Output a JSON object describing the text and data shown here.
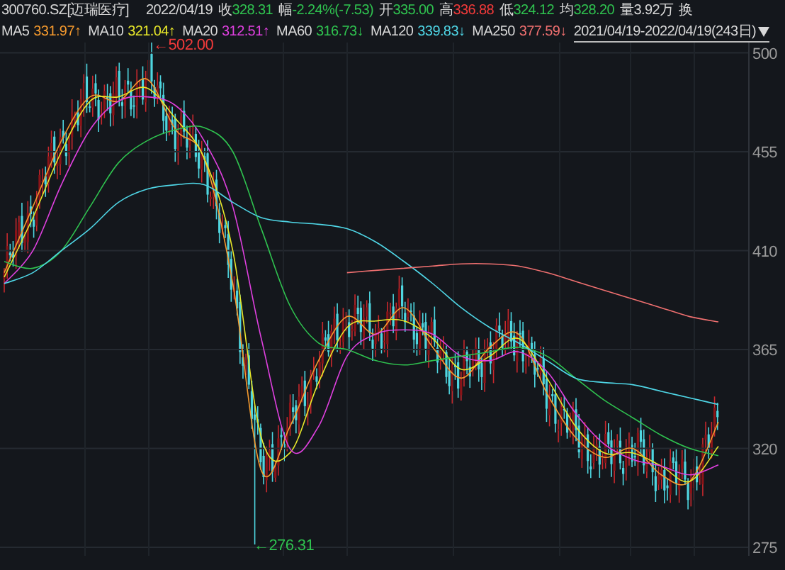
{
  "header": {
    "symbol": "300760.SZ[迈瑞医疗]",
    "date": "2022/04/19",
    "quotes": [
      {
        "label": "收",
        "value": "328.31",
        "color": "#2fc24f"
      },
      {
        "label": "幅",
        "value": "-2.24%(-7.53)",
        "color": "#2fc24f"
      },
      {
        "label": "开",
        "value": "335.00",
        "color": "#2fc24f"
      },
      {
        "label": "高",
        "value": "336.88",
        "color": "#f23a3a"
      },
      {
        "label": "低",
        "value": "324.12",
        "color": "#2fc24f"
      },
      {
        "label": "均",
        "value": "328.20",
        "color": "#2fc24f"
      },
      {
        "label": "量",
        "value": "3.92万",
        "color": "#d8d8d8"
      },
      {
        "label": "换"
      }
    ]
  },
  "ma_legend": [
    {
      "value": "331.97",
      "arrow": "↑"
    },
    {
      "value": "321.04",
      "arrow": "↑"
    },
    {
      "value": "312.51",
      "arrow": "↑"
    },
    {
      "value": "316.73",
      "arrow": "↓"
    },
    {
      "value": "339.83",
      "arrow": "↓"
    },
    {
      "value": "377.59",
      "arrow": "↓"
    }
  ],
  "range": {
    "text": "2021/04/19-2022/04/19(243日)"
  },
  "chart": {
    "high_label": "←502.00",
    "low_label": "←276.31",
    "chart_data": {
      "type": "line",
      "grid": true,
      "ylim": [
        275,
        504.7
      ],
      "yticks": [
        {
          "value": 500,
          "label": "500"
        },
        {
          "value": 455,
          "label": "455"
        },
        {
          "value": 410,
          "label": "410"
        },
        {
          "value": 365,
          "label": "365"
        },
        {
          "value": 320,
          "label": "320"
        },
        {
          "value": 275,
          "label": "275"
        }
      ],
      "series": [
        {
          "name": "MA5",
          "color": "#f59a2e",
          "values": [
            400,
            430,
            460,
            480,
            478,
            488,
            465,
            452,
            395,
            310,
            330,
            360,
            380,
            372,
            384,
            366,
            352,
            366,
            372,
            345,
            325,
            316,
            320,
            308,
            305,
            332
          ]
        },
        {
          "name": "MA10",
          "color": "#e8e82a",
          "values": [
            398,
            425,
            455,
            478,
            480,
            484,
            470,
            452,
            410,
            325,
            318,
            350,
            375,
            378,
            378,
            370,
            356,
            362,
            370,
            352,
            330,
            318,
            318,
            312,
            305,
            321
          ]
        },
        {
          "name": "MA20",
          "color": "#e040e0",
          "values": [
            395,
            410,
            440,
            465,
            478,
            480,
            476,
            460,
            430,
            370,
            320,
            330,
            362,
            372,
            374,
            372,
            362,
            360,
            364,
            355,
            336,
            322,
            315,
            312,
            308,
            312.5
          ]
        },
        {
          "name": "MA60",
          "color": "#2fc24f",
          "values": [
            405,
            402,
            410,
            430,
            450,
            460,
            465,
            466,
            455,
            420,
            385,
            368,
            365,
            360,
            358,
            360,
            362,
            364,
            366,
            362,
            352,
            342,
            334,
            326,
            320,
            316.7
          ]
        },
        {
          "name": "MA120",
          "color": "#4fd6e6",
          "values": [
            395,
            400,
            410,
            420,
            432,
            438,
            440,
            440,
            432,
            425,
            423,
            422,
            420,
            414,
            405,
            395,
            384,
            375,
            368,
            360,
            352,
            350,
            349,
            346,
            343,
            340
          ]
        },
        {
          "name": "MA250",
          "color": "#f07070",
          "values": [
            null,
            null,
            null,
            null,
            null,
            null,
            null,
            null,
            null,
            null,
            null,
            null,
            400,
            401,
            402,
            403,
            404,
            404,
            403,
            400,
            396,
            392,
            388,
            384,
            380,
            377.6
          ]
        }
      ]
    }
  }
}
